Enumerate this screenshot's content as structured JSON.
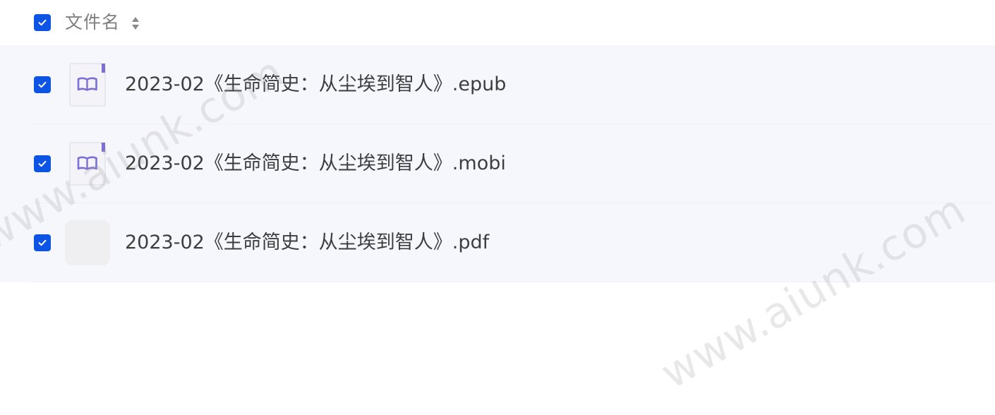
{
  "header": {
    "column_label": "文件名",
    "select_all_checked": true
  },
  "files": [
    {
      "name": "2023-02《生命简史：从尘埃到智人》.epub",
      "type": "book-icon",
      "checked": true
    },
    {
      "name": "2023-02《生命简史：从尘埃到智人》.mobi",
      "type": "book-icon",
      "checked": true
    },
    {
      "name": "2023-02《生命简史：从尘埃到智人》.pdf",
      "type": "thumbnail-placeholder",
      "checked": true
    }
  ],
  "watermark": {
    "text": "www.aiunk.com"
  },
  "colors": {
    "checkbox": "#0d53e4",
    "row_background": "#f6f7fd",
    "book_icon": "#7b6fd6",
    "text": "#3e3e3e",
    "header_text": "#808080"
  }
}
